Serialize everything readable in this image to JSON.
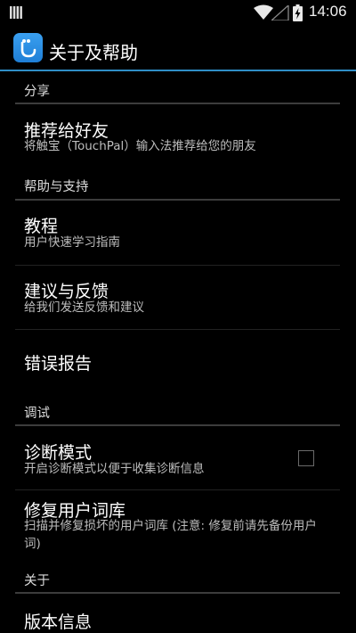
{
  "status_bar": {
    "time": "14:06",
    "icons": [
      "notification-grid-icon",
      "wifi-icon",
      "signal-icon",
      "battery-charging-icon"
    ]
  },
  "action_bar": {
    "title": "关于及帮助",
    "app_icon": "touchpal-app-icon"
  },
  "sections": [
    {
      "header": "分享",
      "items": [
        {
          "title": "推荐给好友",
          "summary": "将触宝（TouchPal）输入法推荐给您的朋友"
        }
      ]
    },
    {
      "header": "帮助与支持",
      "items": [
        {
          "title": "教程",
          "summary": "用户快速学习指南"
        },
        {
          "title": "建议与反馈",
          "summary": "给我们发送反馈和建议"
        },
        {
          "title": "错误报告",
          "summary": ""
        }
      ]
    },
    {
      "header": "调试",
      "items": [
        {
          "title": "诊断模式",
          "summary": "开启诊断模式以便于收集诊断信息",
          "checked": false
        },
        {
          "title": "修复用户词库",
          "summary": "扫描并修复损坏的用户词库 (注意: 修复前请先备份用户词)"
        }
      ]
    },
    {
      "header": "关于",
      "items": [
        {
          "title": "版本信息",
          "summary": ""
        }
      ]
    }
  ],
  "colors": {
    "background": "#000000",
    "accent_divider": "#2f8ec7",
    "app_icon": "#2a8fe6",
    "summary_text": "#bdbdbd"
  }
}
